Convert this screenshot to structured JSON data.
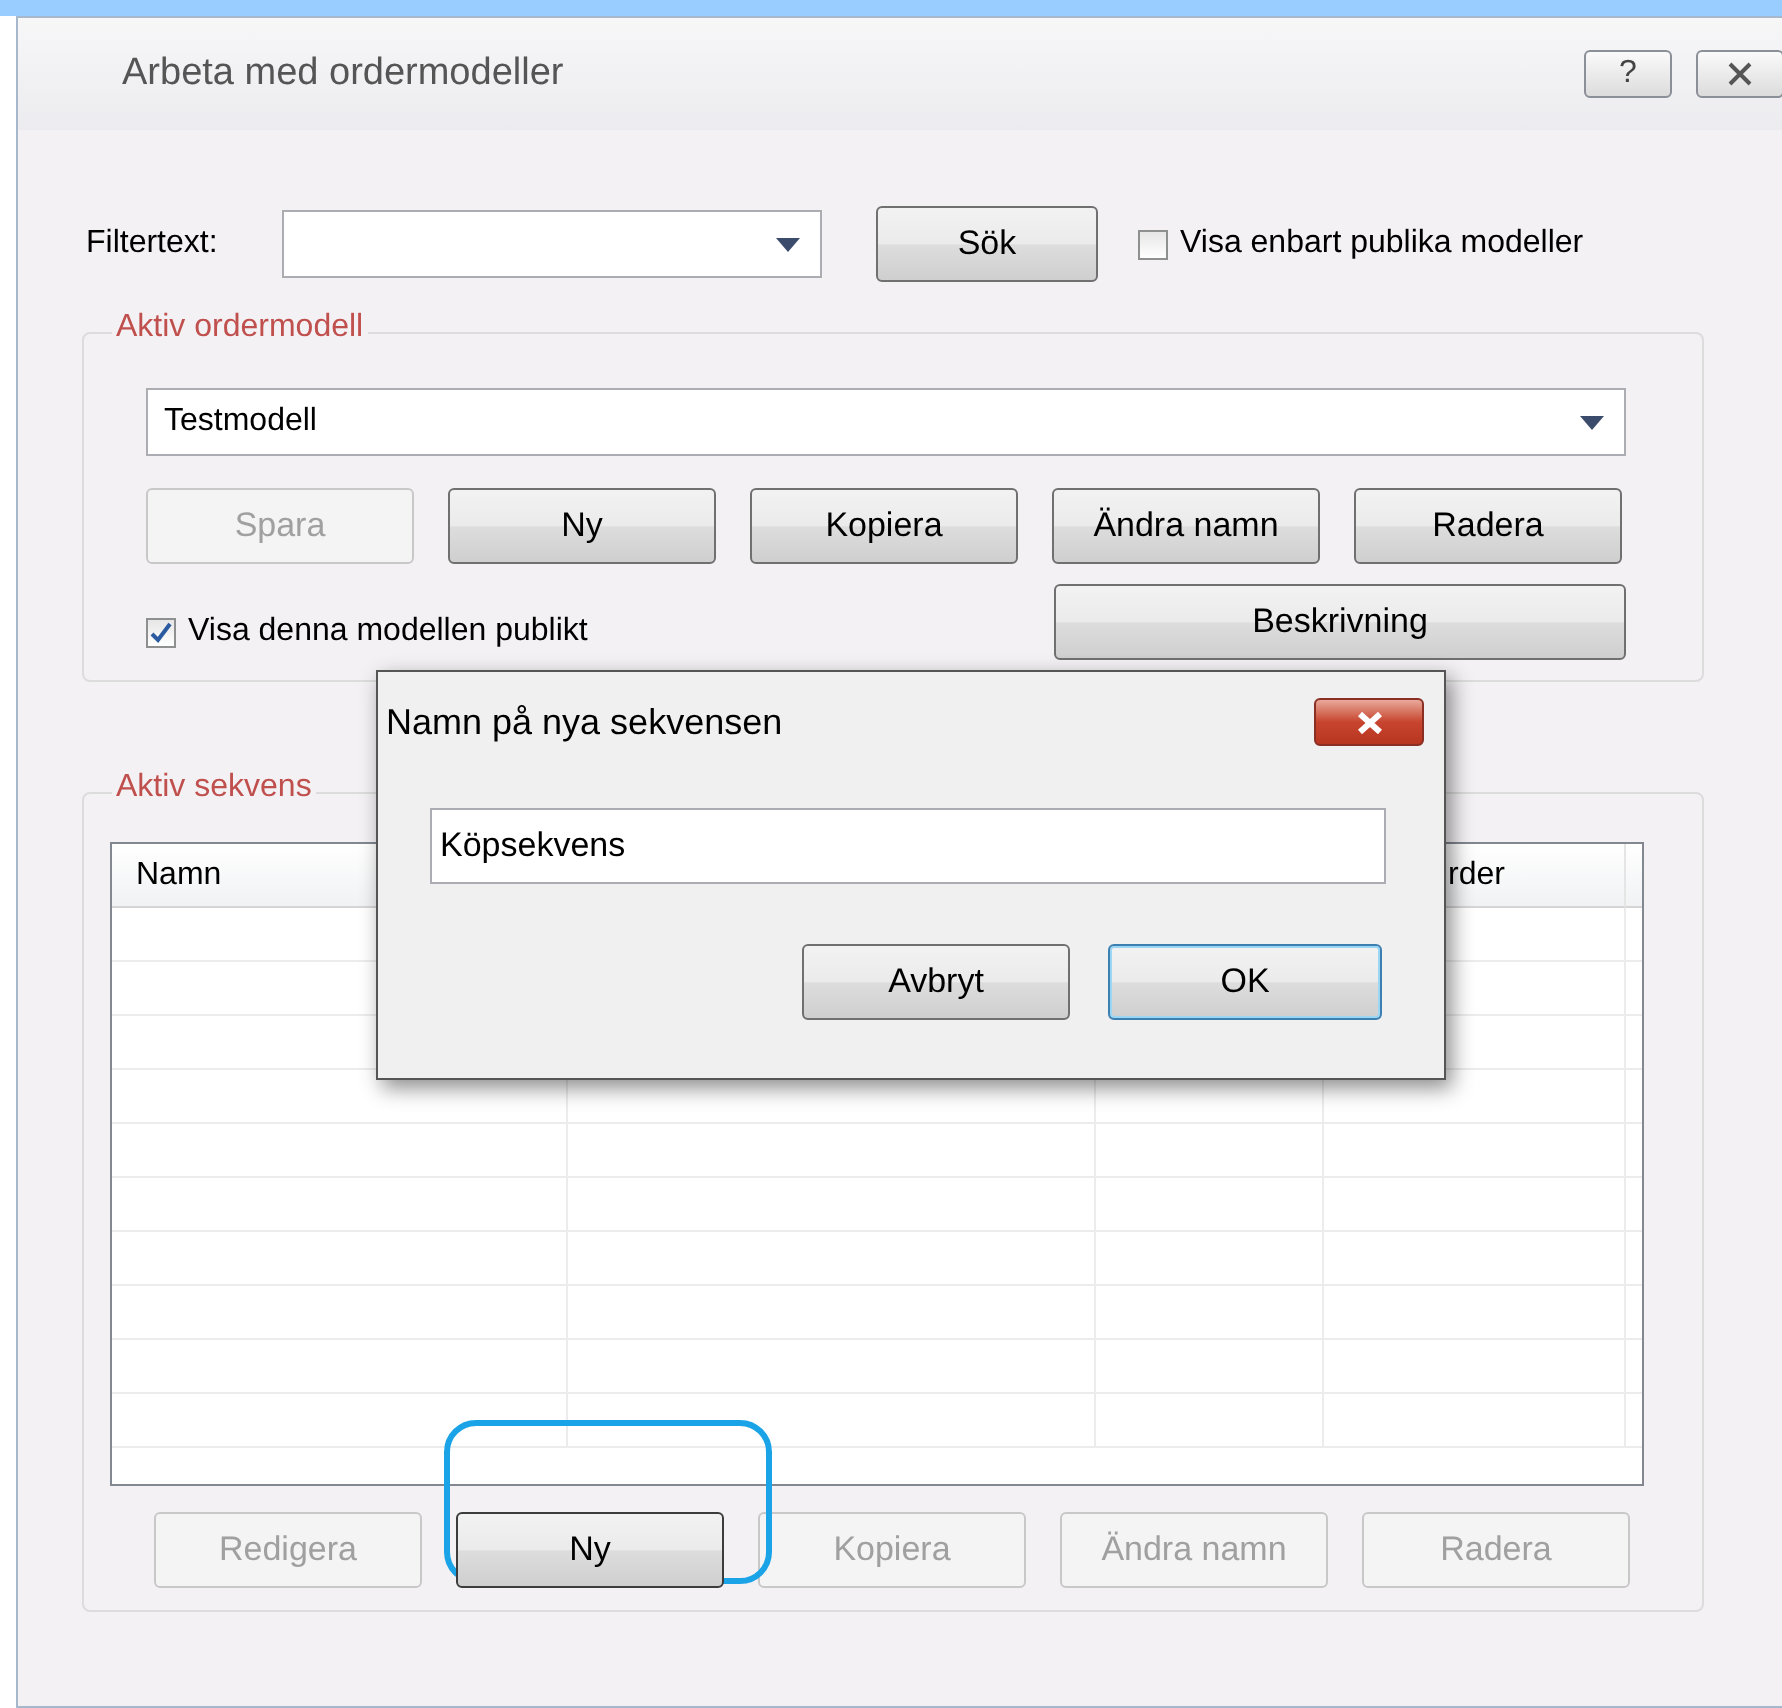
{
  "window": {
    "title": "Arbeta med ordermodeller",
    "help_button": "?"
  },
  "filter": {
    "label": "Filtertext:",
    "search_button": "Sök",
    "public_only": {
      "label": "Visa enbart publika modeller",
      "checked": false
    }
  },
  "active_model": {
    "legend": "Aktiv ordermodell",
    "value": "Testmodell",
    "buttons": [
      {
        "label": "Spara",
        "disabled": true
      },
      {
        "label": "Ny",
        "disabled": false
      },
      {
        "label": "Kopiera",
        "disabled": false
      },
      {
        "label": "Ändra namn",
        "disabled": false
      },
      {
        "label": "Radera",
        "disabled": false
      }
    ],
    "show_public": {
      "label": "Visa denna modellen publikt",
      "checked": true
    },
    "description_button": "Beskrivning"
  },
  "active_sequence": {
    "legend": "Aktiv sekvens",
    "columns": [
      "Namn",
      "rder"
    ],
    "buttons": [
      {
        "label": "Redigera",
        "disabled": true,
        "highlighted": false
      },
      {
        "label": "Ny",
        "disabled": false,
        "highlighted": true
      },
      {
        "label": "Kopiera",
        "disabled": true,
        "highlighted": false
      },
      {
        "label": "Ändra namn",
        "disabled": true,
        "highlighted": false
      },
      {
        "label": "Radera",
        "disabled": true,
        "highlighted": false
      }
    ]
  },
  "dialog": {
    "title": "Namn på nya sekvensen",
    "value": "Köpsekvens",
    "buttons": [
      {
        "label": "Avbryt",
        "default": false
      },
      {
        "label": "OK",
        "default": true
      }
    ]
  }
}
